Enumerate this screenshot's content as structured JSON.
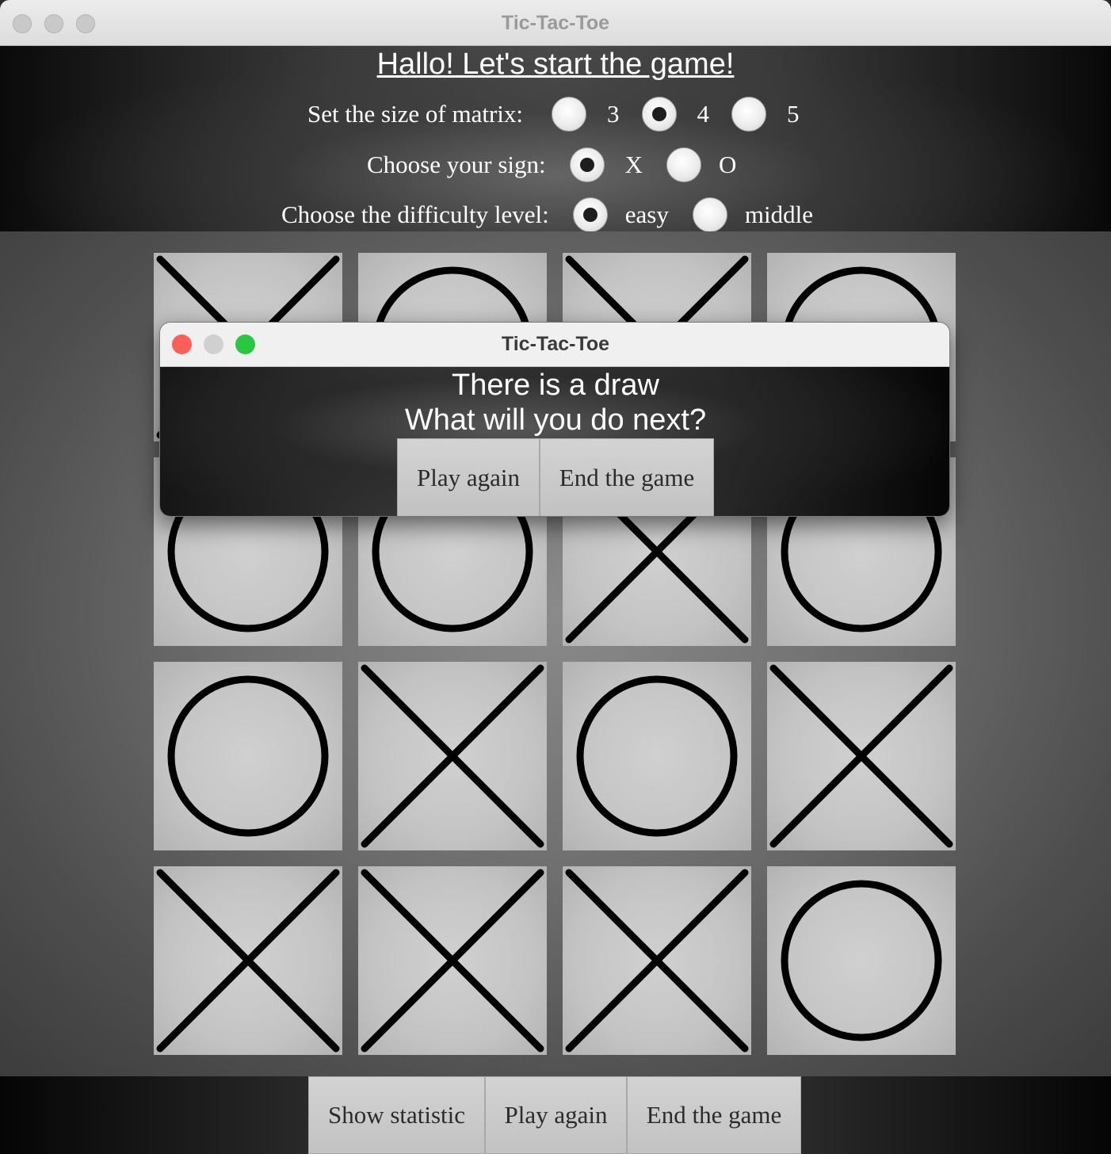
{
  "window": {
    "title": "Tic-Tac-Toe"
  },
  "header": {
    "headline": "Hallo! Let's start the game!",
    "matrix": {
      "label": "Set the size of matrix:",
      "options": [
        "3",
        "4",
        "5"
      ],
      "selected": "4"
    },
    "sign": {
      "label": "Choose your sign:",
      "options": [
        "X",
        "O"
      ],
      "selected": "X"
    },
    "difficulty": {
      "label": "Choose the difficulty level:",
      "options": [
        "easy",
        "middle"
      ],
      "selected": "easy"
    }
  },
  "board": {
    "size": 4,
    "cells": [
      [
        "X",
        "O",
        "X",
        "O"
      ],
      [
        "",
        "",
        "",
        ""
      ],
      [
        "O",
        "O",
        "X",
        "O"
      ],
      [
        "O",
        "X",
        "O",
        "X"
      ],
      [
        "X",
        "X",
        "X",
        "O"
      ]
    ]
  },
  "footer": {
    "show_statistic": "Show statistic",
    "play_again": "Play again",
    "end_game": "End the game"
  },
  "dialog": {
    "title": "Tic-Tac-Toe",
    "line1": "There is a draw",
    "line2": "What will you do next?",
    "play_again": "Play again",
    "end_game": "End the game",
    "traffic_colors": {
      "close": "#ff5f57",
      "minimize": "#d0d0d0",
      "zoom": "#28c840"
    }
  }
}
